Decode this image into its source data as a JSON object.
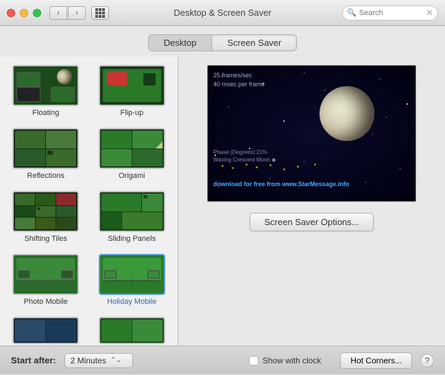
{
  "titlebar": {
    "title": "Desktop & Screen Saver",
    "search_placeholder": "Search"
  },
  "tabs": {
    "desktop_label": "Desktop",
    "screensaver_label": "Screen Saver",
    "active": "screensaver"
  },
  "screensavers": [
    {
      "id": "floating",
      "label": "Floating",
      "selected": false
    },
    {
      "id": "flipup",
      "label": "Flip-up",
      "selected": false
    },
    {
      "id": "reflections",
      "label": "Reflections",
      "selected": false
    },
    {
      "id": "origami",
      "label": "Origami",
      "selected": false
    },
    {
      "id": "shifting",
      "label": "Shifting Tiles",
      "selected": false
    },
    {
      "id": "sliding",
      "label": "Sliding Panels",
      "selected": false
    },
    {
      "id": "photomobile",
      "label": "Photo Mobile",
      "selected": false
    },
    {
      "id": "holidaymobile",
      "label": "Holiday Mobile",
      "selected": true
    },
    {
      "id": "bottom1",
      "label": "",
      "selected": false
    },
    {
      "id": "bottom2",
      "label": "",
      "selected": false
    }
  ],
  "preview": {
    "text_fps": "25 frames/sec",
    "text_frame": "40 msec per frame",
    "text_phase": "Phase (Degrees):21%",
    "text_waxing": "Waxing Crescent Moon ◆",
    "text_download": "download for free from www.StarMessage.info"
  },
  "options_button": "Screen Saver Options...",
  "bottom": {
    "start_after_label": "Start after:",
    "start_after_value": "2 Minutes",
    "show_clock_label": "Show with clock",
    "hot_corners_label": "Hot Corners...",
    "help_label": "?"
  }
}
